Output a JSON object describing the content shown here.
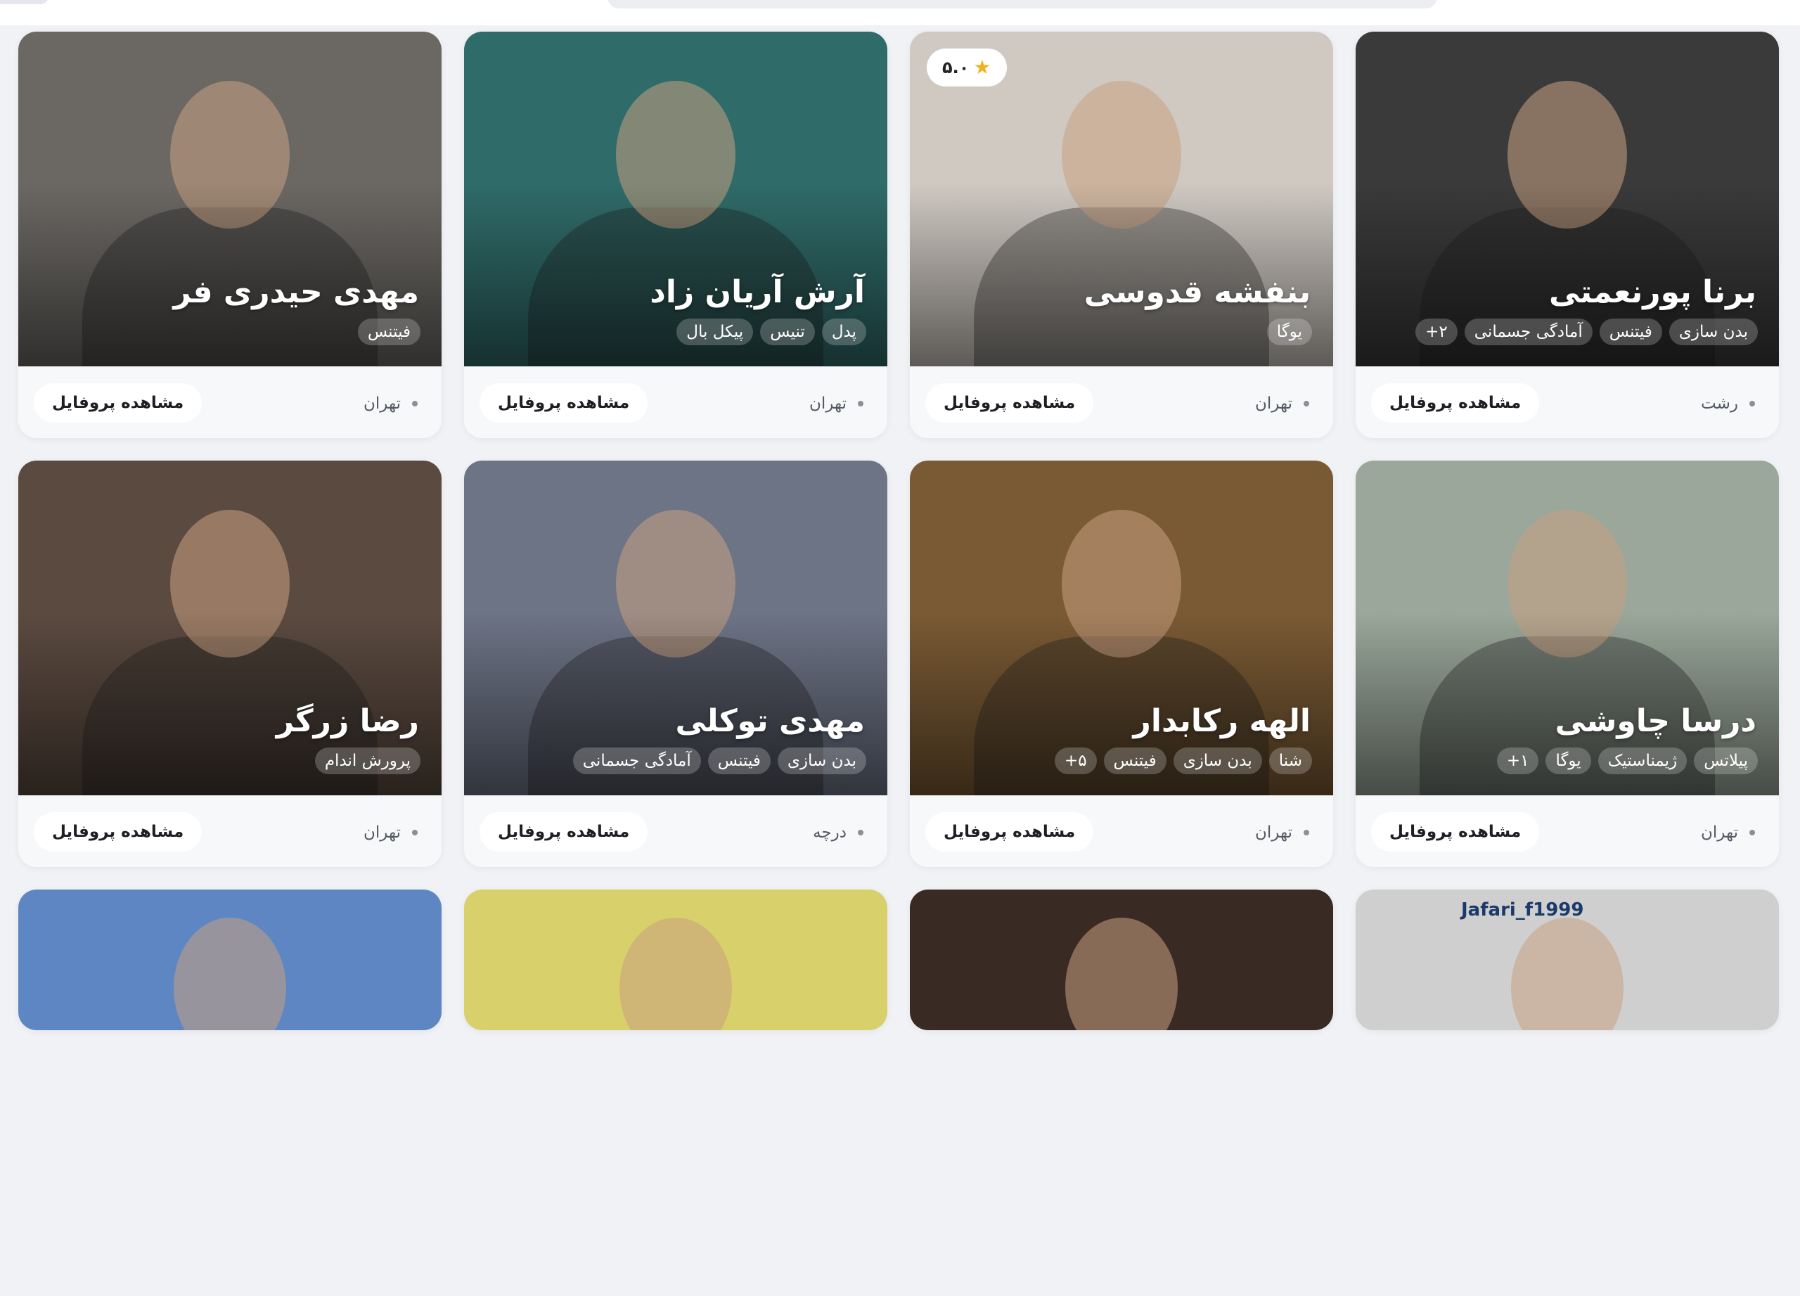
{
  "footer_action_label": "مشاهده پروفایل",
  "trainers": [
    {
      "name": "برنا پورنعمتی",
      "tags": [
        "بدن سازی",
        "فیتنس",
        "آمادگی جسمانی",
        "۲+"
      ],
      "city": "رشت",
      "rating": null,
      "bg": "#3a3a3a"
    },
    {
      "name": "بنفشه قدوسی",
      "tags": [
        "یوگا"
      ],
      "city": "تهران",
      "rating": "۵.۰",
      "bg": "#cfc9c2"
    },
    {
      "name": "آرش آریان زاد",
      "tags": [
        "پدل",
        "تنیس",
        "پیکل بال"
      ],
      "city": "تهران",
      "rating": null,
      "bg": "#2f6b69"
    },
    {
      "name": "مهدی حیدری فر",
      "tags": [
        "فیتنس"
      ],
      "city": "تهران",
      "rating": null,
      "bg": "#6b6864"
    },
    {
      "name": "درسا چاوشی",
      "tags": [
        "پیلاتس",
        "ژیمناستیک",
        "یوگا",
        "۱+"
      ],
      "city": "تهران",
      "rating": null,
      "bg": "#9aa79a"
    },
    {
      "name": "الهه رکابدار",
      "tags": [
        "شنا",
        "بدن سازی",
        "فیتنس",
        "۵+"
      ],
      "city": "تهران",
      "rating": null,
      "bg": "#7a5a34"
    },
    {
      "name": "مهدی توکلی",
      "tags": [
        "بدن سازی",
        "فیتنس",
        "آمادگی جسمانی"
      ],
      "city": "درچه",
      "rating": null,
      "bg": "#6d7486"
    },
    {
      "name": "رضا زرگر",
      "tags": [
        "پرورش اندام"
      ],
      "city": "تهران",
      "rating": null,
      "bg": "#5b4a40"
    }
  ],
  "partial_cards": [
    {
      "bg": "#cfcfcf",
      "caption": "Jafari_f1999"
    },
    {
      "bg": "#3a2a24",
      "caption": ""
    },
    {
      "bg": "#d8d06a",
      "caption": ""
    },
    {
      "bg": "#5d86c2",
      "caption": ""
    }
  ]
}
